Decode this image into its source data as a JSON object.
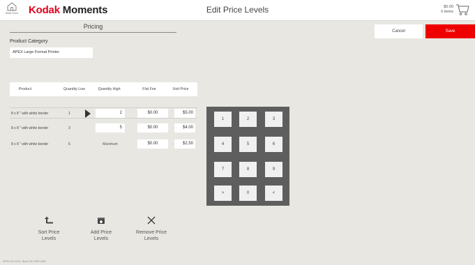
{
  "header": {
    "start_over_label": "Start Over",
    "brand_kodak": "Kodak",
    "brand_moments": " Moments",
    "title": "Edit Price Levels",
    "cart_total": "$0.00",
    "cart_items": "0 items"
  },
  "pricing": {
    "title": "Pricing",
    "cancel_label": "Cancel",
    "save_label": "Save",
    "category_label": "Product Category",
    "category_value": "APEX Large Format Printer"
  },
  "table": {
    "columns": [
      "Product",
      "Quantity Low",
      "Quantity High",
      "Flat Fee",
      "Unit Price"
    ],
    "rows": [
      {
        "product": "8 x 8 \" with white border",
        "qty_low": "1",
        "qty_high": "2",
        "flat_fee": "$0.00",
        "unit_price": "$5.00"
      },
      {
        "product": "8 x 8 \" with white border",
        "qty_low": "3",
        "qty_high": "5",
        "flat_fee": "$0.00",
        "unit_price": "$4.00"
      },
      {
        "product": "8 x 8 \" with white border",
        "qty_low": "6",
        "qty_high": "Maximum",
        "flat_fee": "$0.00",
        "unit_price": "$2.50"
      }
    ]
  },
  "keypad": {
    "keys": [
      "1",
      "2",
      "3",
      "4",
      "5",
      "6",
      "7",
      "8",
      "9",
      ">",
      "0",
      "<"
    ]
  },
  "actions": {
    "sort": "Sort Price\nLevels",
    "sort_l1": "Sort Price",
    "sort_l2": "Levels",
    "add_l1": "Add Price",
    "add_l2": "Levels",
    "remove_l1": "Remove Price",
    "remove_l2": "Levels"
  },
  "footer": {
    "version": "APEX V6.0 (T9) - Build 2017.0927.0000"
  },
  "colors": {
    "accent": "#ee0000",
    "brand_red": "#e3001b",
    "background": "#e9e7e2",
    "keypad_bg": "#5e5e5e"
  }
}
